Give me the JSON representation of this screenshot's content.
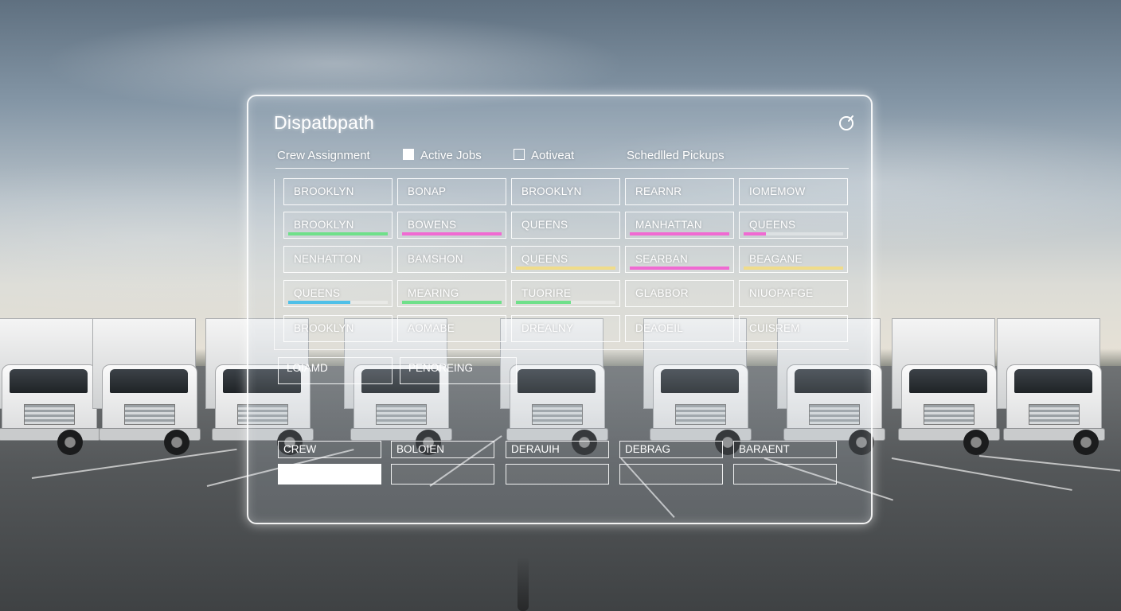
{
  "app": {
    "title": "Dispatbpath"
  },
  "tabs": [
    {
      "label": "Crew Assignment",
      "checkbox": "none"
    },
    {
      "label": "Active Jobs",
      "checkbox": "checked"
    },
    {
      "label": "Aotiveat",
      "checkbox": "unchecked"
    },
    {
      "label": "Schedlled Pickups",
      "checkbox": "none"
    }
  ],
  "grid": {
    "rows": [
      [
        {
          "label": "BROOKLYN"
        },
        {
          "label": "BONAP"
        },
        {
          "label": "BROOKLYN"
        },
        {
          "label": "REARNR"
        },
        {
          "label": "IOMEMOW"
        }
      ],
      [
        {
          "label": "BROOKLYN",
          "progress": 1.0,
          "color": "#6fe08a"
        },
        {
          "label": "BOWENS",
          "progress": 1.0,
          "color": "#f06ad2"
        },
        {
          "label": "QUEENS"
        },
        {
          "label": "MANHATTAN",
          "progress": 1.0,
          "color": "#f06ad2"
        },
        {
          "label": "QUEENS",
          "progress": 0.22,
          "color": "#f06ad2"
        }
      ],
      [
        {
          "label": "NENHATTON"
        },
        {
          "label": "BAMSHON"
        },
        {
          "label": "QUEENS",
          "progress": 1.0,
          "color": "#f0dc8a"
        },
        {
          "label": "SEARBAN",
          "progress": 1.0,
          "color": "#f06ad2"
        },
        {
          "label": "BEAGANE",
          "progress": 1.0,
          "color": "#f0dc8a"
        }
      ],
      [
        {
          "label": "QUEENS",
          "progress": 0.62,
          "color": "#4fc0e8"
        },
        {
          "label": "MEARING",
          "progress": 1.0,
          "color": "#6fe08a"
        },
        {
          "label": "TUORIRE",
          "progress": 0.55,
          "color": "#6fe08a"
        },
        {
          "label": "GLABBOR"
        },
        {
          "label": "NIUOPAFGE"
        }
      ],
      [
        {
          "label": "BROOKLYN"
        },
        {
          "label": "AOMABE"
        },
        {
          "label": "DREALNY"
        },
        {
          "label": "DEAOEIL"
        },
        {
          "label": "CUISREM"
        }
      ]
    ]
  },
  "fields": [
    {
      "label": "LOIAMD"
    },
    {
      "label": "PENOREING"
    }
  ],
  "bottom_table": {
    "headers": [
      "CREW",
      "BOLOIEN",
      "DERAUIH",
      "DEBRAG",
      "BARAENT"
    ]
  }
}
